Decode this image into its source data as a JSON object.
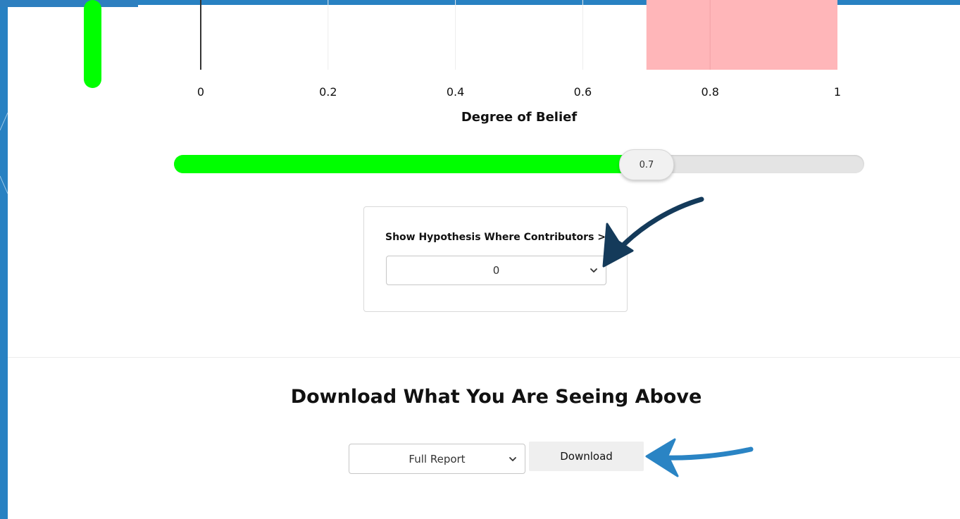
{
  "chart_data": {
    "type": "bar",
    "xlabel": "Degree of Belief",
    "xlim": [
      0,
      1
    ],
    "x_ticks": [
      "0",
      "0.2",
      "0.4",
      "0.6",
      "0.8",
      "1"
    ],
    "bars": [
      {
        "x_start": 0.7,
        "x_end": 1.0
      }
    ],
    "vertical_lines": [
      0.2,
      0.4,
      0.6,
      0.8
    ],
    "zero_line": 0,
    "bar_color": "#ffb6b9",
    "side_indicator_color": "#00ff00"
  },
  "slider": {
    "value": "0.7",
    "value_number": 0.7,
    "fill_color": "#00ff00"
  },
  "filter": {
    "label": "Show Hypothesis Where Contributors >",
    "selected": "0"
  },
  "download": {
    "heading": "Download What You Are Seeing Above",
    "report_selected": "Full Report",
    "button_label": "Download"
  },
  "icons": {
    "select_chevron": "chevron-down-icon",
    "annotation_arrow_dark": "arrow-pointer-icon",
    "annotation_arrow_blue": "arrow-pointer-icon"
  },
  "colors": {
    "frame_blue": "#2881c2",
    "arrow_dark": "#143a5a",
    "arrow_blue": "#2a84c4"
  }
}
